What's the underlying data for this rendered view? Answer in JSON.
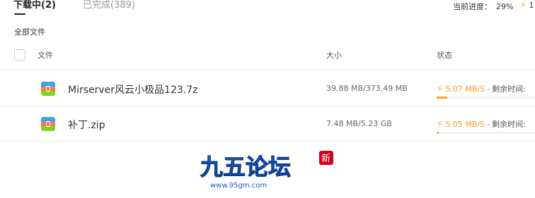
{
  "tabs": [
    {
      "label": "下载中(2)",
      "active": true
    },
    {
      "label": "已完成(389)",
      "active": false
    }
  ],
  "summary": {
    "label": "当前进度：",
    "value": "29%",
    "extra": "1"
  },
  "breadcrumb": "全部文件",
  "columns": {
    "file": "文件",
    "size": "大小",
    "status": "状态"
  },
  "rows": [
    {
      "name": "Mirserver风云小极品123.7z",
      "size": "39.88 MB/373.49 MB",
      "speed": "5.07 MB/S",
      "separator": "-",
      "remain_label": "剩余时间:",
      "progress": 0.11,
      "icon": "archive-icon"
    },
    {
      "name": "补丁.zip",
      "size": "7.48 MB/5.23 GB",
      "speed": "5.05 MB/S",
      "separator": "-",
      "remain_label": "剩余时间:",
      "progress": 0.0014,
      "icon": "archive-icon"
    }
  ],
  "watermark": {
    "title": "九五论坛",
    "url": "www.95gm.com",
    "stamp": "新"
  },
  "colors": {
    "accent": "#f5a623",
    "active_tab": "#222222",
    "inactive_tab": "#999999",
    "divider": "#eeeeee"
  }
}
